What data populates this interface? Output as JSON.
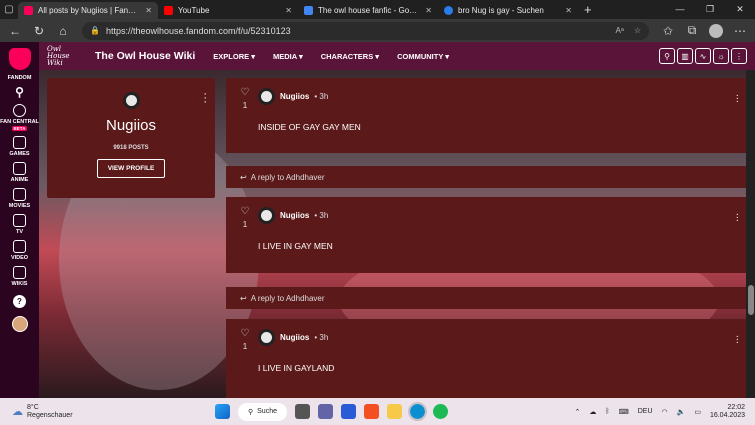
{
  "browser": {
    "tabs": [
      {
        "title": "All posts by Nugiios | Fandom",
        "color": "#fa005a",
        "active": true
      },
      {
        "title": "YouTube",
        "color": "#ff0000",
        "active": false
      },
      {
        "title": "The owl house fanfic - Google Do",
        "color": "#4285f4",
        "active": false
      },
      {
        "title": "bro Nug is gay - Suchen",
        "color": "#2b7de9",
        "active": false
      }
    ],
    "url": "https://theowlhouse.fandom.com/f/u/52310123"
  },
  "sidebar": {
    "items": [
      {
        "label": "FANDOM"
      },
      {
        "label": "FAN CENTRAL",
        "badge": "BETA"
      },
      {
        "label": "GAMES"
      },
      {
        "label": "ANIME"
      },
      {
        "label": "MOVIES"
      },
      {
        "label": "TV"
      },
      {
        "label": "VIDEO"
      },
      {
        "label": "WIKIS"
      }
    ]
  },
  "header": {
    "logo_text": "Owl House Wiki",
    "wiki_name": "The Owl House Wiki",
    "nav": [
      "EXPLORE ▾",
      "MEDIA ▾",
      "CHARACTERS ▾",
      "COMMUNITY ▾"
    ]
  },
  "profile": {
    "name": "Nugiios",
    "posts": "9918 POSTS",
    "button": "VIEW PROFILE"
  },
  "posts": [
    {
      "author": "Nugiios",
      "time": "• 3h",
      "likes": "1",
      "text": "INSIDE OF GAY GAY MEN"
    },
    {
      "author": "Nugiios",
      "time": "• 3h",
      "likes": "1",
      "text": "I LIVE IN  GAY MEN"
    },
    {
      "author": "Nugiios",
      "time": "• 3h",
      "likes": "1",
      "text": "I LIVE IN GAYLAND"
    }
  ],
  "replies": [
    "A reply to Adhdhaver",
    "A reply to Adhdhaver"
  ],
  "taskbar": {
    "temp": "8°C",
    "weather": "Regenschauer",
    "search": "Suche",
    "lang": "DEU",
    "time": "22:02",
    "date": "16.04.2023"
  }
}
